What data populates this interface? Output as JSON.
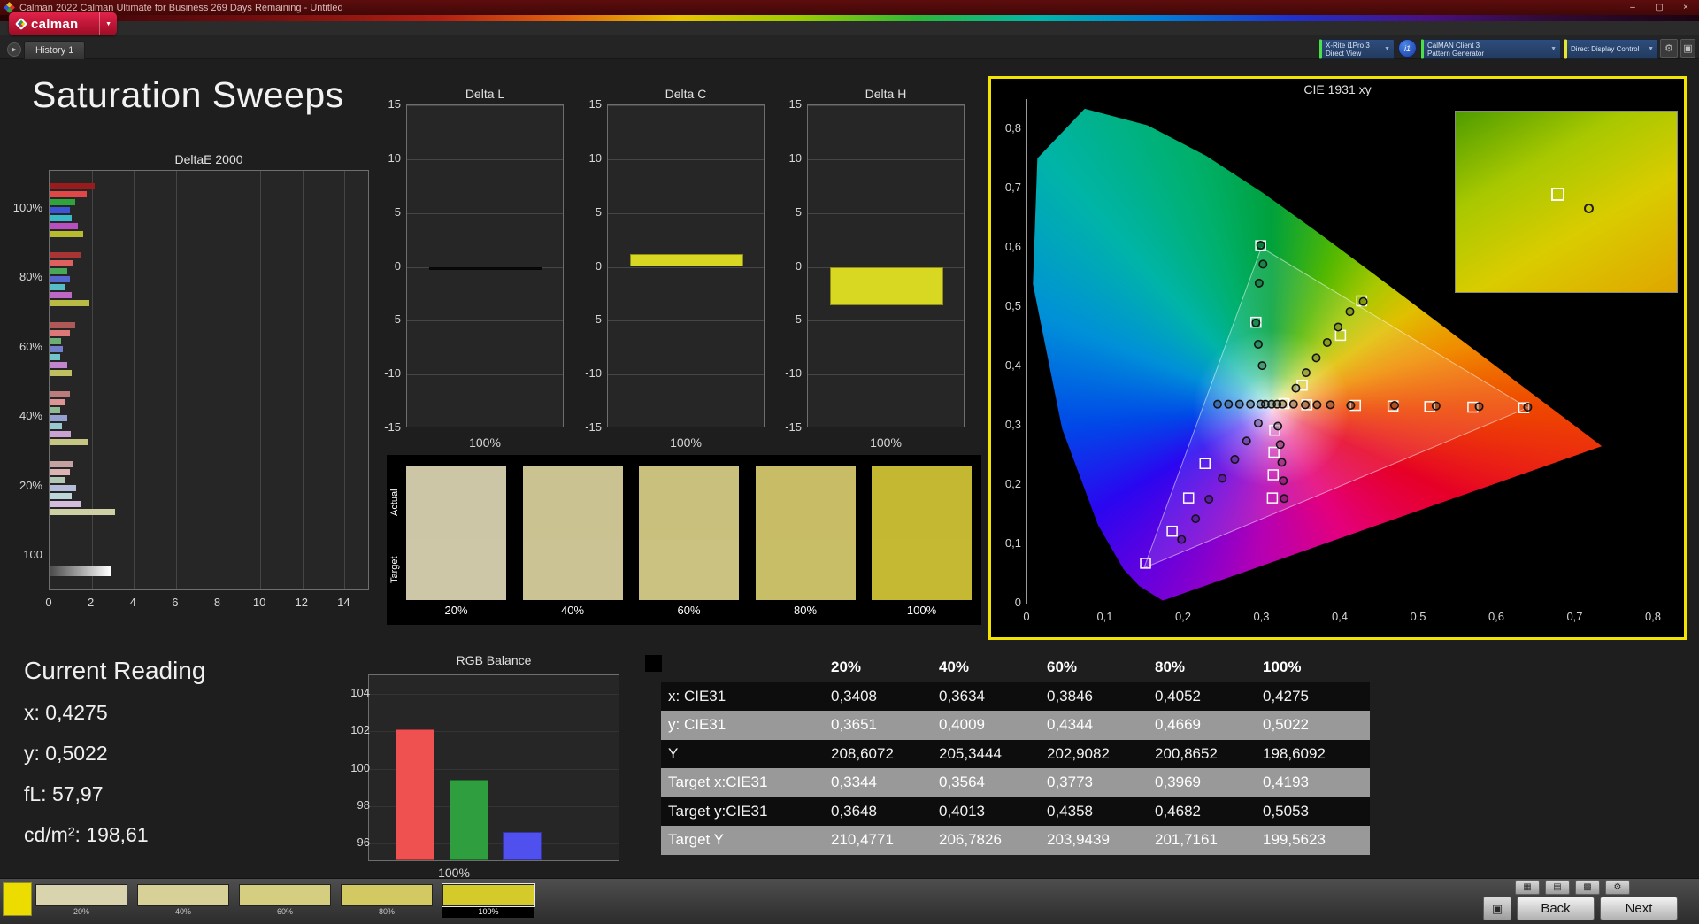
{
  "window": {
    "title": "Calman 2022 Calman Ultimate for Business 269 Days Remaining  - Untitled"
  },
  "icons": {
    "dropdown": "▼",
    "gear": "⚙",
    "pattern": "▣",
    "play": "▶",
    "minimize": "–",
    "maximize": "▢",
    "close": "×"
  },
  "logo": {
    "text": "calman"
  },
  "nav": {
    "history_tab": "History 1"
  },
  "devices": {
    "meter": {
      "line1": "X-Rite i1Pro 3",
      "line2": "Direct View",
      "accent": "#4ae04a"
    },
    "badge": "i1",
    "source": {
      "line1": "CalMAN Client 3",
      "line2": "Pattern Generator",
      "accent": "#4ae04a"
    },
    "display": {
      "line1": "Direct Display Control",
      "line2": "",
      "accent": "#e6e62e"
    }
  },
  "page": {
    "title": "Saturation Sweeps"
  },
  "charts": {
    "deltaE2000": {
      "type": "bar-horizontal-grouped",
      "title": "DeltaE 2000",
      "xticks": [
        0,
        2,
        4,
        6,
        8,
        10,
        12,
        14
      ],
      "xlim": [
        0,
        15.2
      ],
      "groups": [
        {
          "label": "100%",
          "colors": [
            "#991c1c",
            "#e04848",
            "#2fa33c",
            "#3b55d6",
            "#38b8c8",
            "#b84fc0",
            "#b8ba30"
          ],
          "values": [
            2.15,
            1.75,
            1.2,
            0.95,
            1.05,
            1.35,
            1.6
          ]
        },
        {
          "label": "80%",
          "colors": [
            "#a83434",
            "#e06060",
            "#4aa658",
            "#5568d0",
            "#55bcc8",
            "#bc68c4",
            "#babb45"
          ],
          "values": [
            1.45,
            1.15,
            0.85,
            0.95,
            0.75,
            1.05,
            1.9
          ]
        },
        {
          "label": "60%",
          "colors": [
            "#b05858",
            "#de7878",
            "#6cae76",
            "#7280cc",
            "#74c2ca",
            "#c284cc",
            "#bfbf62"
          ],
          "values": [
            1.2,
            0.95,
            0.55,
            0.65,
            0.5,
            0.85,
            1.05
          ]
        },
        {
          "label": "40%",
          "colors": [
            "#ba7c7c",
            "#dc9494",
            "#90ba96",
            "#94a0d0",
            "#98cad0",
            "#caa2d2",
            "#c6c684"
          ],
          "values": [
            0.95,
            0.75,
            0.5,
            0.85,
            0.6,
            1.0,
            1.8
          ]
        },
        {
          "label": "20%",
          "colors": [
            "#c4a2a2",
            "#dcb4b4",
            "#b2c8b4",
            "#b4bcda",
            "#bcd6da",
            "#d6bcdc",
            "#cfcfa6"
          ],
          "values": [
            1.15,
            0.95,
            0.7,
            1.25,
            1.05,
            1.45,
            3.1
          ]
        },
        {
          "label": "100",
          "colors": [
            "luminance"
          ],
          "values": [
            2.9
          ]
        }
      ]
    },
    "delta_ylim": [
      -15,
      15
    ],
    "delta_yticks": [
      15,
      10,
      5,
      0,
      -5,
      -10,
      -15
    ],
    "delta_small": [
      {
        "type": "bar",
        "title": "Delta L",
        "value": -0.25,
        "bar_color": "#0a0a0a",
        "xlabel": "100%"
      },
      {
        "type": "bar",
        "title": "Delta C",
        "value": 1.2,
        "bar_color": "#d8d822",
        "xlabel": "100%"
      },
      {
        "type": "bar",
        "title": "Delta H",
        "value": -3.6,
        "bar_color": "#d8d822",
        "xlabel": "100%"
      }
    ],
    "rgb_balance": {
      "type": "bar",
      "title": "RGB Balance",
      "xlabel": "100%",
      "ylim": [
        95,
        105
      ],
      "yticks": [
        104,
        102,
        100,
        98,
        96
      ],
      "series": [
        {
          "name": "Red",
          "value": 102.0,
          "color": "#ef5050"
        },
        {
          "name": "Green",
          "value": 99.3,
          "color": "#2f9e3f"
        },
        {
          "name": "Blue",
          "value": 96.5,
          "color": "#5050ee"
        }
      ]
    },
    "cie": {
      "type": "scatter",
      "title": "CIE 1931 xy",
      "xticks": [
        "0",
        "0,1",
        "0,2",
        "0,3",
        "0,4",
        "0,5",
        "0,6",
        "0,7",
        "0,8"
      ],
      "yticks": [
        "0",
        "0,1",
        "0,2",
        "0,3",
        "0,4",
        "0,5",
        "0,6",
        "0,7",
        "0,8"
      ],
      "white_point": [
        0.313,
        0.329
      ],
      "srgb_triangle": [
        [
          0.64,
          0.33
        ],
        [
          0.3,
          0.6
        ],
        [
          0.15,
          0.06
        ]
      ],
      "measured": [
        [
          0.305,
          0.336
        ],
        [
          0.313,
          0.336
        ],
        [
          0.32,
          0.336
        ],
        [
          0.327,
          0.336
        ],
        [
          0.341,
          0.336
        ],
        [
          0.356,
          0.335
        ],
        [
          0.371,
          0.335
        ],
        [
          0.388,
          0.335
        ],
        [
          0.414,
          0.334
        ],
        [
          0.47,
          0.334
        ],
        [
          0.523,
          0.333
        ],
        [
          0.578,
          0.332
        ],
        [
          0.64,
          0.331
        ],
        [
          0.299,
          0.336
        ],
        [
          0.286,
          0.336
        ],
        [
          0.272,
          0.336
        ],
        [
          0.258,
          0.336
        ],
        [
          0.244,
          0.336
        ],
        [
          0.344,
          0.363
        ],
        [
          0.357,
          0.389
        ],
        [
          0.37,
          0.414
        ],
        [
          0.384,
          0.44
        ],
        [
          0.398,
          0.466
        ],
        [
          0.413,
          0.492
        ],
        [
          0.43,
          0.509
        ],
        [
          0.301,
          0.401
        ],
        [
          0.296,
          0.437
        ],
        [
          0.293,
          0.473
        ],
        [
          0.297,
          0.54
        ],
        [
          0.302,
          0.572
        ],
        [
          0.299,
          0.604
        ],
        [
          0.296,
          0.304
        ],
        [
          0.281,
          0.274
        ],
        [
          0.266,
          0.243
        ],
        [
          0.25,
          0.211
        ],
        [
          0.233,
          0.176
        ],
        [
          0.216,
          0.143
        ],
        [
          0.198,
          0.108
        ],
        [
          0.321,
          0.299
        ],
        [
          0.324,
          0.268
        ],
        [
          0.326,
          0.238
        ],
        [
          0.328,
          0.207
        ],
        [
          0.329,
          0.177
        ]
      ],
      "targets": [
        [
          0.329,
          0.337
        ],
        [
          0.358,
          0.335
        ],
        [
          0.42,
          0.334
        ],
        [
          0.468,
          0.333
        ],
        [
          0.515,
          0.332
        ],
        [
          0.57,
          0.331
        ],
        [
          0.635,
          0.33
        ],
        [
          0.352,
          0.368
        ],
        [
          0.401,
          0.452
        ],
        [
          0.428,
          0.51
        ],
        [
          0.293,
          0.474
        ],
        [
          0.299,
          0.603
        ],
        [
          0.228,
          0.236
        ],
        [
          0.207,
          0.178
        ],
        [
          0.186,
          0.122
        ],
        [
          0.152,
          0.068
        ],
        [
          0.317,
          0.292
        ],
        [
          0.316,
          0.255
        ],
        [
          0.315,
          0.217
        ],
        [
          0.314,
          0.178
        ]
      ]
    }
  },
  "swatch_panel": {
    "row_labels": [
      "Actual",
      "Target"
    ],
    "items": [
      {
        "label": "20%",
        "actual": "#ccc6a6",
        "target": "#cdc7a8"
      },
      {
        "label": "40%",
        "actual": "#cbc292",
        "target": "#ccc394"
      },
      {
        "label": "60%",
        "actual": "#cac07e",
        "target": "#cbc180"
      },
      {
        "label": "80%",
        "actual": "#c8bd66",
        "target": "#c9be68"
      },
      {
        "label": "100%",
        "actual": "#c4b832",
        "target": "#c5b934"
      }
    ]
  },
  "current_reading": {
    "title": "Current Reading",
    "lines": [
      "x: 0,4275",
      "y: 0,5022",
      "fL: 57,97",
      "cd/m²: 198,61"
    ]
  },
  "table": {
    "columns": [
      "20%",
      "40%",
      "60%",
      "80%",
      "100%"
    ],
    "rows": [
      {
        "label": "x: CIE31",
        "values": [
          "0,3408",
          "0,3634",
          "0,3846",
          "0,4052",
          "0,4275"
        ]
      },
      {
        "label": "y: CIE31",
        "values": [
          "0,3651",
          "0,4009",
          "0,4344",
          "0,4669",
          "0,5022"
        ]
      },
      {
        "label": "Y",
        "values": [
          "208,6072",
          "205,3444",
          "202,9082",
          "200,8652",
          "198,6092"
        ]
      },
      {
        "label": "Target x:CIE31",
        "values": [
          "0,3344",
          "0,3564",
          "0,3773",
          "0,3969",
          "0,4193"
        ]
      },
      {
        "label": "Target y:CIE31",
        "values": [
          "0,3648",
          "0,4013",
          "0,4358",
          "0,4682",
          "0,5053"
        ]
      },
      {
        "label": "Target Y",
        "values": [
          "210,4771",
          "206,7826",
          "203,9439",
          "201,7161",
          "199,5623"
        ]
      }
    ]
  },
  "bottom": {
    "current_patch_color": "#eddc00",
    "swatches": [
      {
        "label": "20%",
        "color": "#d9d4ae",
        "selected": false
      },
      {
        "label": "40%",
        "color": "#d7d097",
        "selected": false
      },
      {
        "label": "60%",
        "color": "#d5cd7f",
        "selected": false
      },
      {
        "label": "80%",
        "color": "#d2c963",
        "selected": false
      },
      {
        "label": "100%",
        "color": "#d4ca2a",
        "selected": true
      }
    ],
    "toolbar": [
      {
        "name": "pattern-display",
        "glyph": "▦"
      },
      {
        "name": "report",
        "glyph": "▤"
      },
      {
        "name": "print",
        "glyph": "▩"
      },
      {
        "name": "settings",
        "glyph": "⚙"
      }
    ],
    "back": "Back",
    "next": "Next"
  }
}
